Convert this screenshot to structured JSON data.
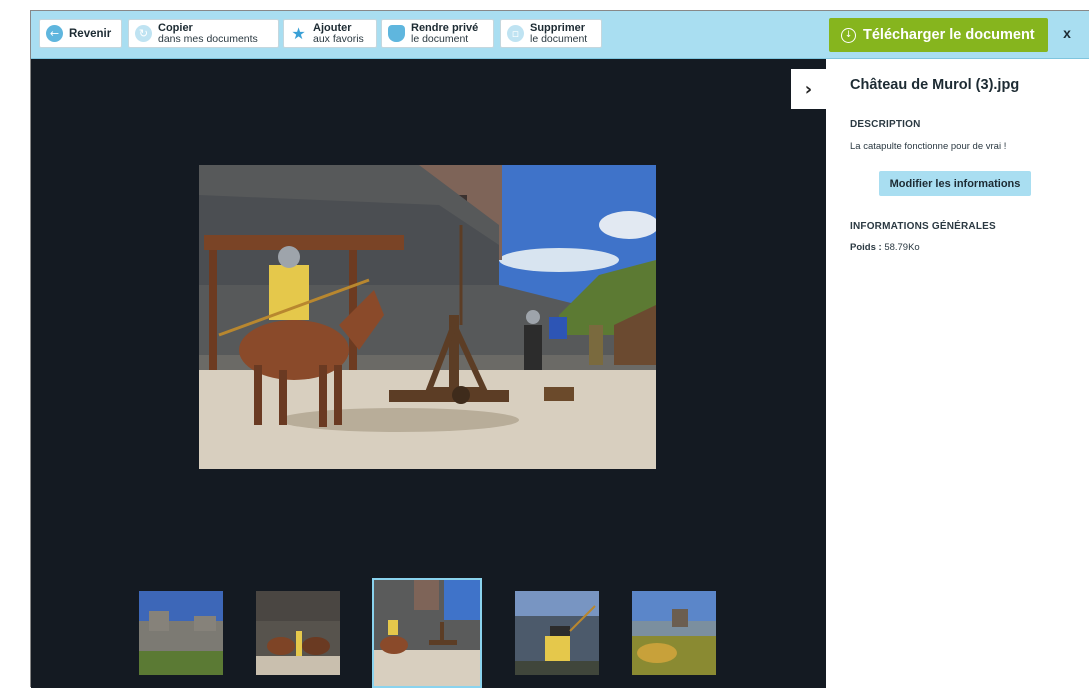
{
  "toolbar": {
    "back": {
      "label": "Revenir",
      "icon": "arrow-left-icon"
    },
    "copy": {
      "line1": "Copier",
      "line2": "dans mes documents",
      "icon": "copy-icon"
    },
    "favorite": {
      "line1": "Ajouter",
      "line2": "aux favoris",
      "icon": "star-icon"
    },
    "private": {
      "line1": "Rendre privé",
      "line2": "le document",
      "icon": "lock-icon"
    },
    "delete": {
      "line1": "Supprimer",
      "line2": "le document",
      "icon": "trash-icon"
    },
    "download": {
      "label": "Télécharger le document",
      "icon": "download-icon"
    },
    "close": "x"
  },
  "viewer": {
    "toggle_icon": "chevron-right-icon",
    "thumbnails_count": 5,
    "active_thumbnail": 3
  },
  "panel": {
    "title": "Château de Murol (3).jpg",
    "description_heading": "DESCRIPTION",
    "description": "La catapulte fonctionne pour de vrai !",
    "edit_button": "Modifier les informations",
    "general_heading": "INFORMATIONS GÉNÉRALES",
    "weight_label": "Poids :",
    "weight_value": "58.79Ko"
  },
  "colors": {
    "toolbar_bg": "#a9def1",
    "download_bg": "#86b51e",
    "viewer_bg": "#141a22",
    "icon_blue": "#5fb6de"
  }
}
